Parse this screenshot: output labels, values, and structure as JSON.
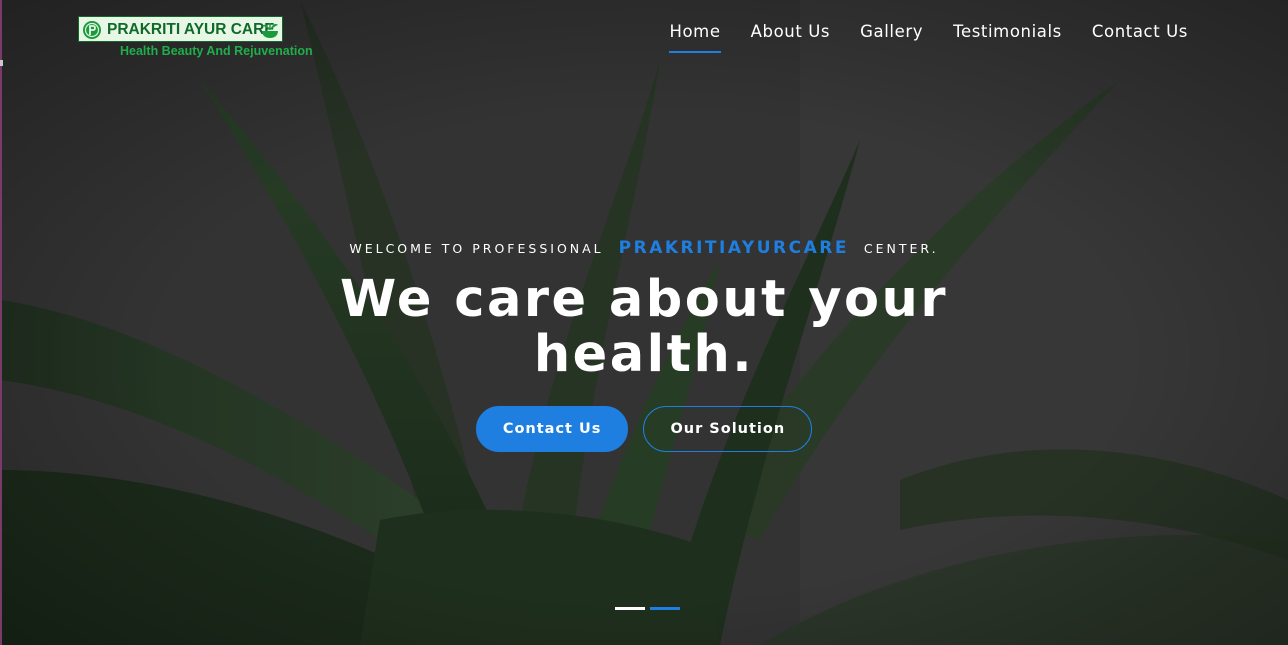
{
  "brand": {
    "name": "PRAKRITI AYUR CARE",
    "tagline": "Health Beauty And Rejuvenation"
  },
  "nav": {
    "items": [
      {
        "label": "Home",
        "active": true
      },
      {
        "label": "About Us",
        "active": false
      },
      {
        "label": "Gallery",
        "active": false
      },
      {
        "label": "Testimonials",
        "active": false
      },
      {
        "label": "Contact Us",
        "active": false
      }
    ]
  },
  "hero": {
    "welcome_prefix": "Welcome to professional",
    "welcome_brand": "PRAKRITIAYURCARE",
    "welcome_suffix": "center.",
    "headline": "We care about your health.",
    "primary_button": "Contact Us",
    "secondary_button": "Our Solution",
    "slides": {
      "count": 2,
      "active_index": 1
    }
  },
  "colors": {
    "accent": "#1e7fe0",
    "brand_green": "#0f6a2a",
    "tagline_green": "#1fae4a",
    "overlay": "#2f2f2f"
  }
}
